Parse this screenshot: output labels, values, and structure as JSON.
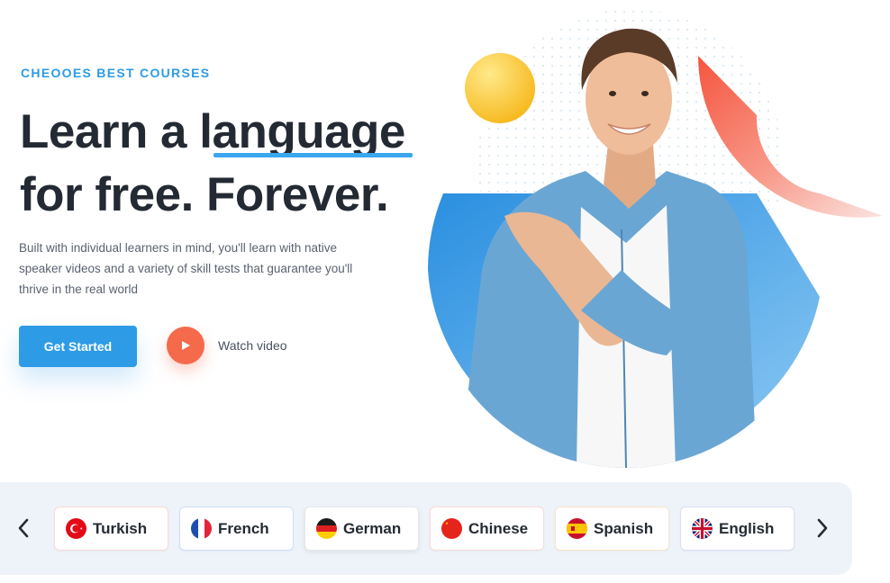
{
  "hero": {
    "eyebrow": "CHEOOES BEST COURSES",
    "headline_part1": "Learn a l",
    "headline_highlight": "anguage",
    "headline_line2": "for free. Forever.",
    "description": "Built with individual learners in mind, you'll learn with native speaker videos and a variety of skill tests that guarantee you'll thrive in the real world",
    "cta_label": "Get Started",
    "watch_label": "Watch video"
  },
  "languages": {
    "items": [
      {
        "label": "Turkish",
        "flag": "turkey-flag-icon",
        "border": "#fbd9d6"
      },
      {
        "label": "French",
        "flag": "france-flag-icon",
        "border": "#cfe0f6"
      },
      {
        "label": "German",
        "flag": "germany-flag-icon",
        "border": "#e6e8ec"
      },
      {
        "label": "Chinese",
        "flag": "china-flag-icon",
        "border": "#fbd9d6"
      },
      {
        "label": "Spanish",
        "flag": "spain-flag-icon",
        "border": "#fbe6c8"
      },
      {
        "label": "English",
        "flag": "uk-flag-icon",
        "border": "#dcdff6"
      }
    ]
  },
  "colors": {
    "accent": "#2d9be6",
    "play": "#f46a4a",
    "headline": "#242a33",
    "bar_bg": "#edf3f9"
  }
}
